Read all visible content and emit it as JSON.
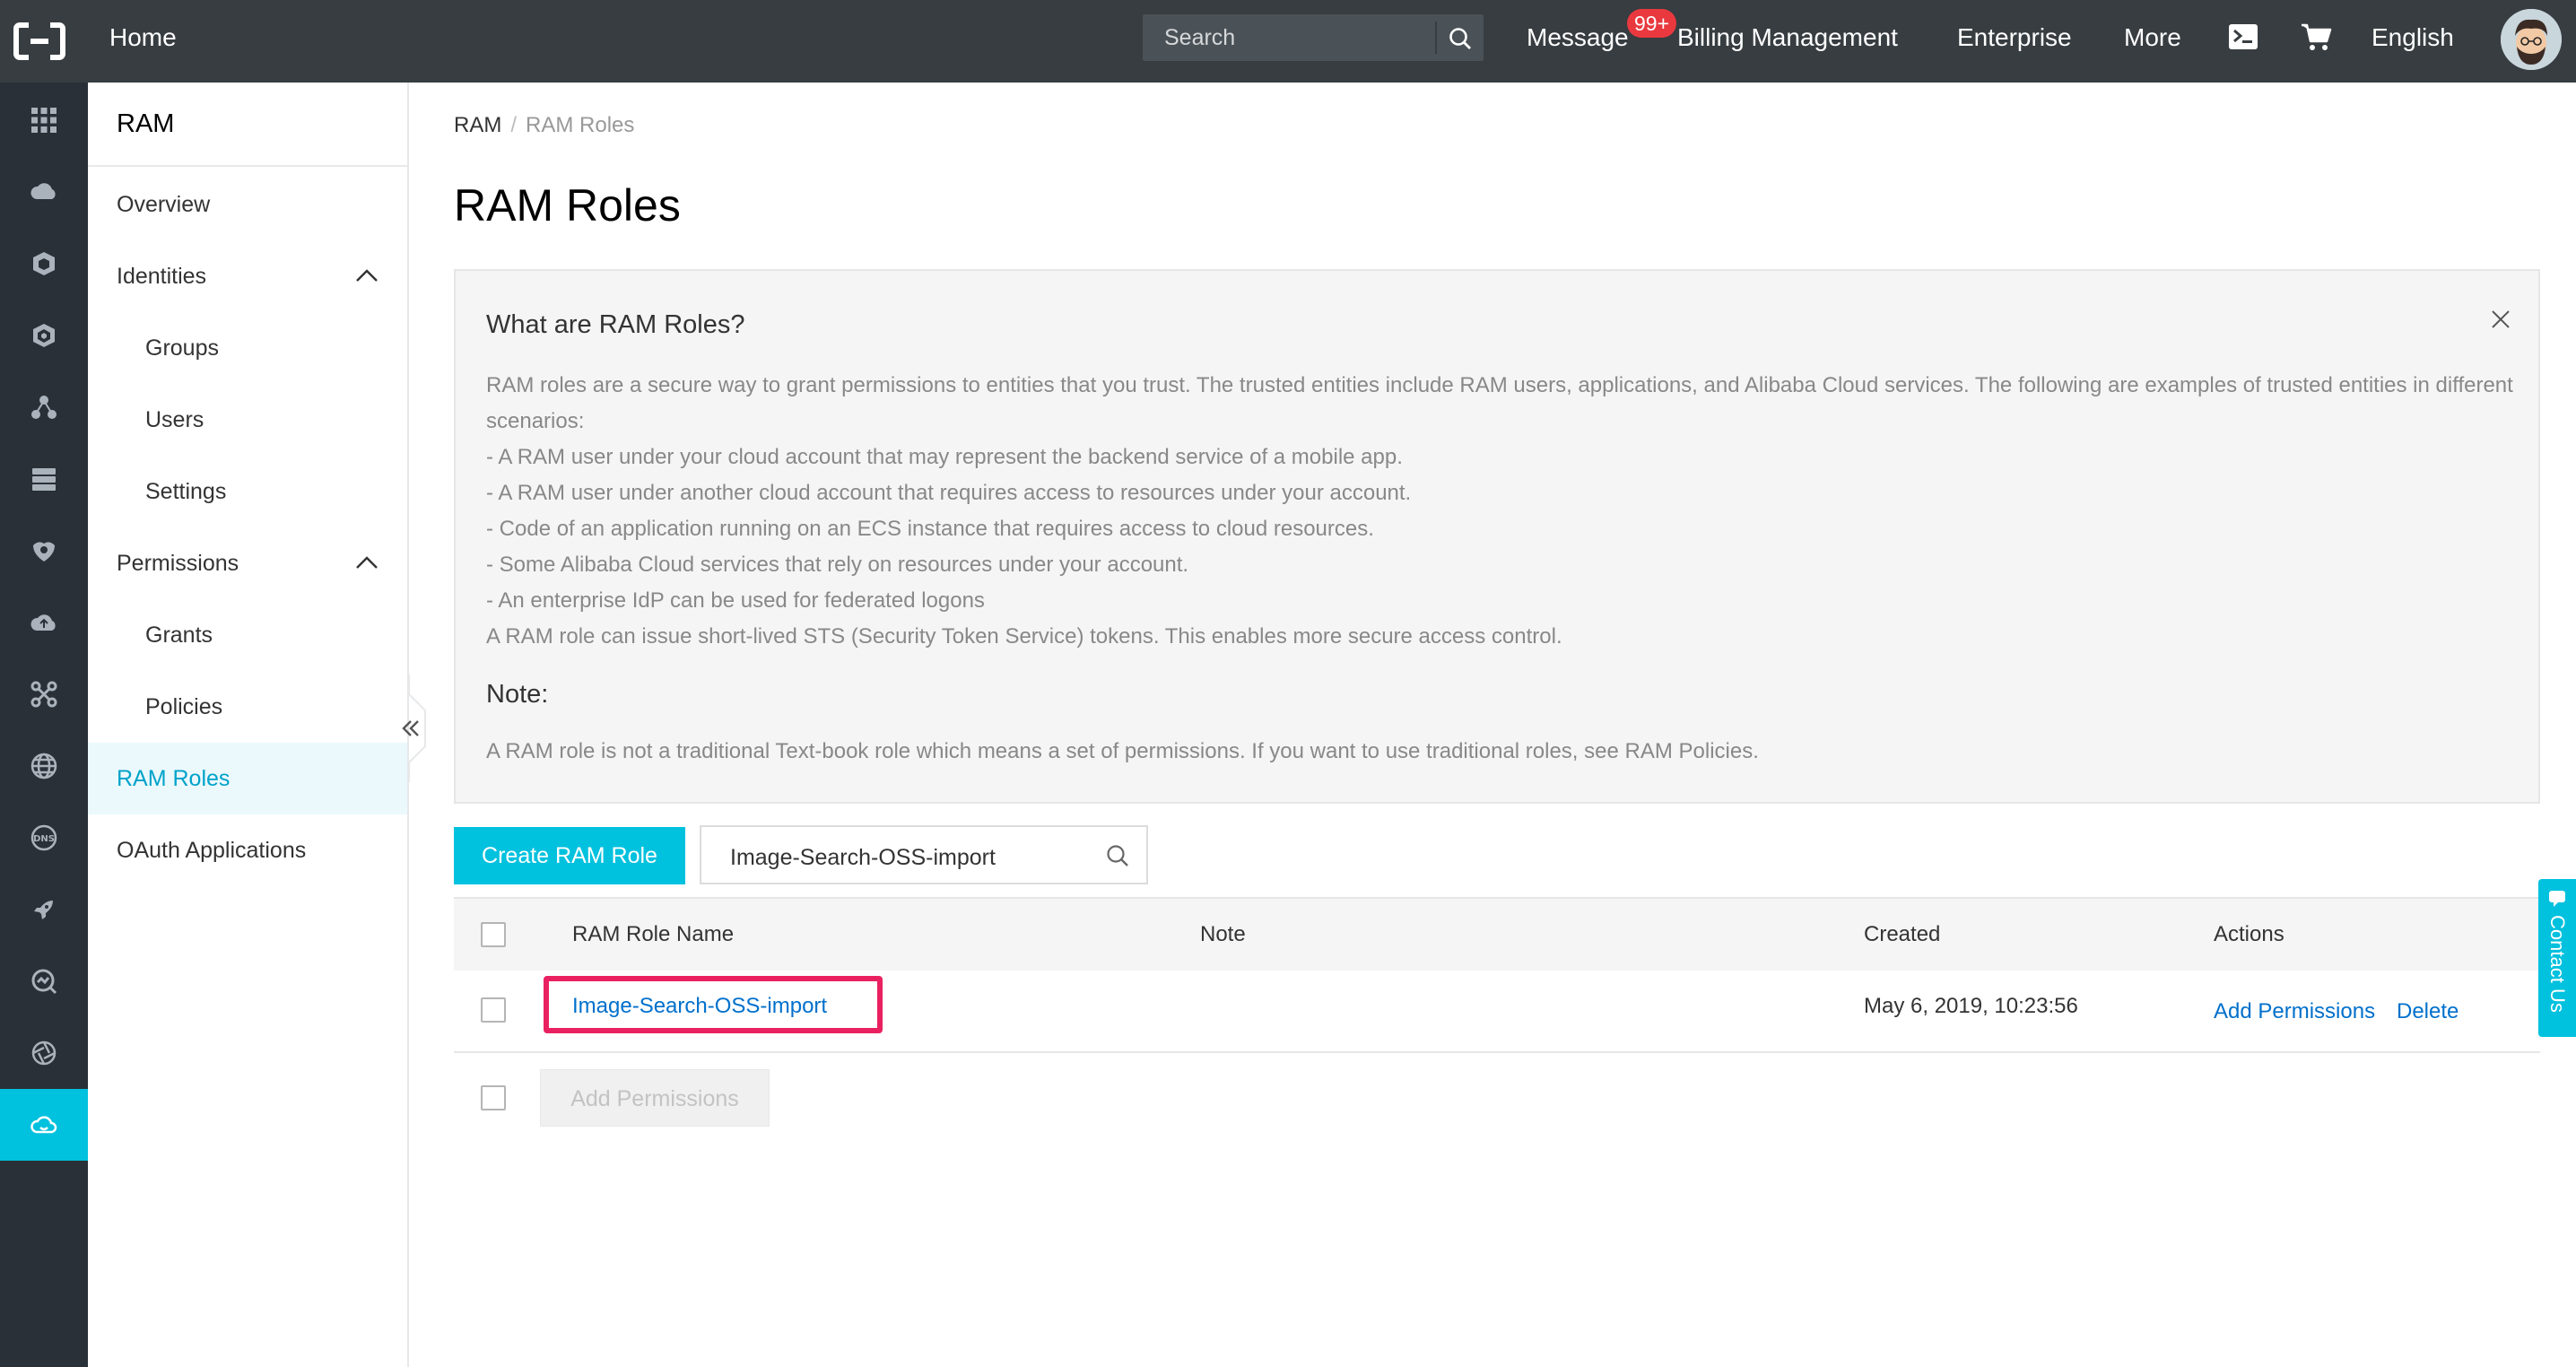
{
  "topbar": {
    "home": "Home",
    "search_placeholder": "Search",
    "message": "Message",
    "message_badge": "99+",
    "billing": "Billing Management",
    "enterprise": "Enterprise",
    "more": "More",
    "language": "English"
  },
  "rail": {
    "icons": [
      "grid-icon",
      "cloud-server-icon",
      "cube-icon",
      "cube-stack-icon",
      "network-icon",
      "storage-icon",
      "security-icon",
      "cloud-icon",
      "scissors-icon",
      "globe-icon",
      "dns-icon",
      "rocket-icon",
      "monitor-icon",
      "aperture-icon",
      "cloud-upload-icon"
    ]
  },
  "sidebar": {
    "title": "RAM",
    "items": [
      {
        "label": "Overview"
      },
      {
        "label": "Identities"
      },
      {
        "label": "Groups"
      },
      {
        "label": "Users"
      },
      {
        "label": "Settings"
      },
      {
        "label": "Permissions"
      },
      {
        "label": "Grants"
      },
      {
        "label": "Policies"
      },
      {
        "label": "RAM Roles"
      },
      {
        "label": "OAuth Applications"
      }
    ]
  },
  "breadcrumb": {
    "root": "RAM",
    "separator": "/",
    "current": "RAM Roles"
  },
  "page_title": "RAM Roles",
  "info": {
    "title": "What are RAM Roles?",
    "body_lines": [
      "RAM roles are a secure way to grant permissions to entities that you trust. The trusted entities include RAM users, applications, and Alibaba Cloud services. The following are examples of trusted entities in different scenarios:",
      "- A RAM user under your cloud account that may represent the backend service of a mobile app.",
      "- A RAM user under another cloud account that requires access to resources under your account.",
      "- Code of an application running on an ECS instance that requires access to cloud resources.",
      "- Some Alibaba Cloud services that rely on resources under your account.",
      "- An enterprise IdP can be used for federated logons",
      "A RAM role can issue short-lived STS (Security Token Service) tokens. This enables more secure access control."
    ],
    "note_title": "Note:",
    "note_text": "A RAM role is not a traditional Text-book role which means a set of permissions. If you want to use traditional roles, see RAM Policies."
  },
  "toolbar": {
    "create_label": "Create RAM Role",
    "filter_value": "Image-Search-OSS-import"
  },
  "table": {
    "columns": [
      "RAM Role Name",
      "Note",
      "Created",
      "Actions"
    ],
    "rows": [
      {
        "name": "Image-Search-OSS-import",
        "note": "",
        "created": "May 6, 2019, 10:23:56",
        "actions": [
          "Add Permissions",
          "Delete"
        ]
      }
    ],
    "batch_button": "Add Permissions"
  },
  "contact": "Contact Us",
  "colors": {
    "accent": "#00c1de",
    "topbar": "#373d41",
    "rail": "#293038",
    "link": "#0070cc",
    "highlight": "#ea2161",
    "badge": "#e9393f"
  }
}
